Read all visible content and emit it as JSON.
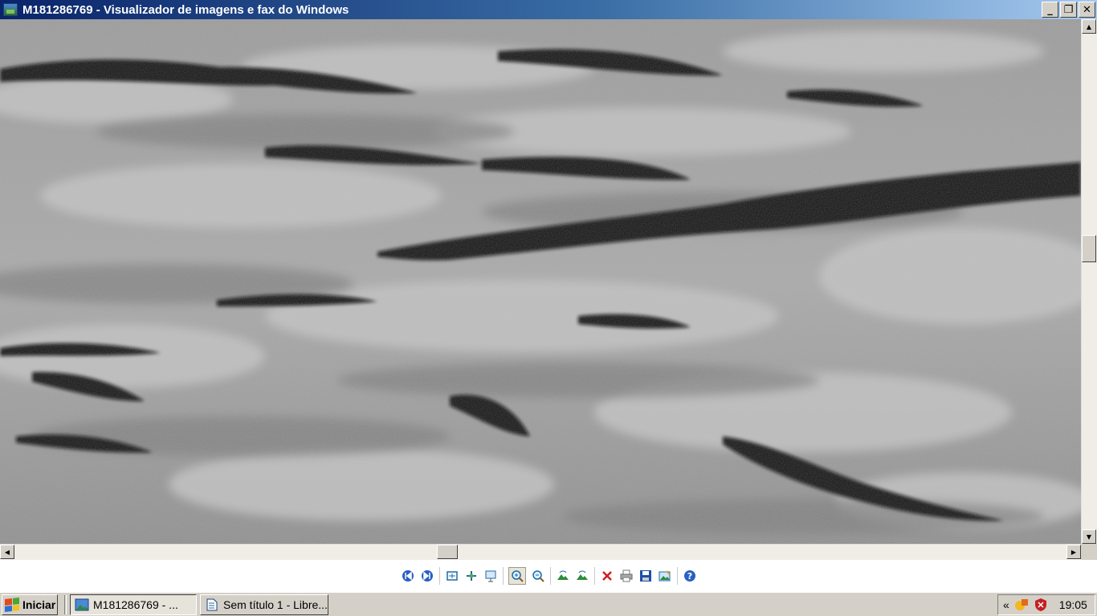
{
  "window": {
    "title": "M181286769 - Visualizador de imagens e fax do Windows",
    "buttons": {
      "minimize": "_",
      "restore": "❐",
      "close": "✕"
    }
  },
  "viewer": {
    "image_subject": "lunar-surface-image",
    "scroll": {
      "vertical_position": 0.43,
      "horizontal_position": 0.41
    }
  },
  "toolbar": {
    "icons": [
      "previous-image-icon",
      "next-image-icon",
      "best-fit-icon",
      "actual-size-icon",
      "slideshow-icon",
      "zoom-in-icon",
      "zoom-out-icon",
      "rotate-clockwise-icon",
      "rotate-counterclockwise-icon",
      "delete-icon",
      "print-icon",
      "save-icon",
      "open-editor-icon",
      "help-icon"
    ]
  },
  "taskbar": {
    "start_label": "Iniciar",
    "tasks": [
      {
        "label": "M181286769 - ...",
        "active": true
      },
      {
        "label": "Sem título 1 - Libre...",
        "active": false
      }
    ],
    "tray": {
      "expand": "«",
      "clock": "19:05"
    }
  },
  "colors": {
    "title_start": "#0A246A",
    "title_end": "#A6CAF0",
    "taskbar": "#D4D0C8"
  }
}
